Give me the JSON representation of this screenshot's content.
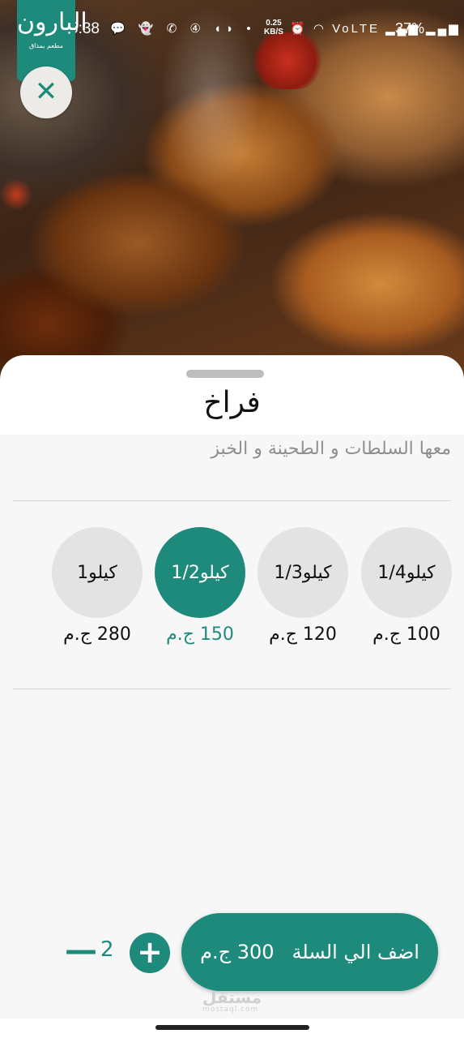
{
  "status_bar": {
    "time": "5:38",
    "notification_icons": "💬 👻 ✆ ④ ◖◗ •",
    "speed_value": "0.25",
    "speed_unit": "KB/S",
    "right_icons": "⏰ ◠ VoLTE ▂▄▆ ▂▄▆",
    "battery": "37%"
  },
  "logo": {
    "mark": "البارون",
    "subtitle": "مطعم بمذاق"
  },
  "product": {
    "title": "فراخ",
    "description": "معها السلطات و الطحينة و الخبز"
  },
  "sizes": [
    {
      "label": "1/4كيلو",
      "price": "100 ج.م",
      "selected": false
    },
    {
      "label": "1/3كيلو",
      "price": "120 ج.م",
      "selected": false
    },
    {
      "label": "كيلو1/2",
      "price": "150 ج.م",
      "selected": true
    },
    {
      "label": "1كيلو",
      "price": "280 ج.م",
      "selected": false
    }
  ],
  "quantity": {
    "minus": "—",
    "value": "2",
    "plus": "+"
  },
  "cart_button": {
    "label": "اضف الي السلة",
    "total": "300 ج.م"
  },
  "watermark": {
    "text": "مستقل",
    "sub": "mostaql.com"
  },
  "colors": {
    "accent": "#1e8a7c",
    "chip": "#e3e3e3"
  }
}
